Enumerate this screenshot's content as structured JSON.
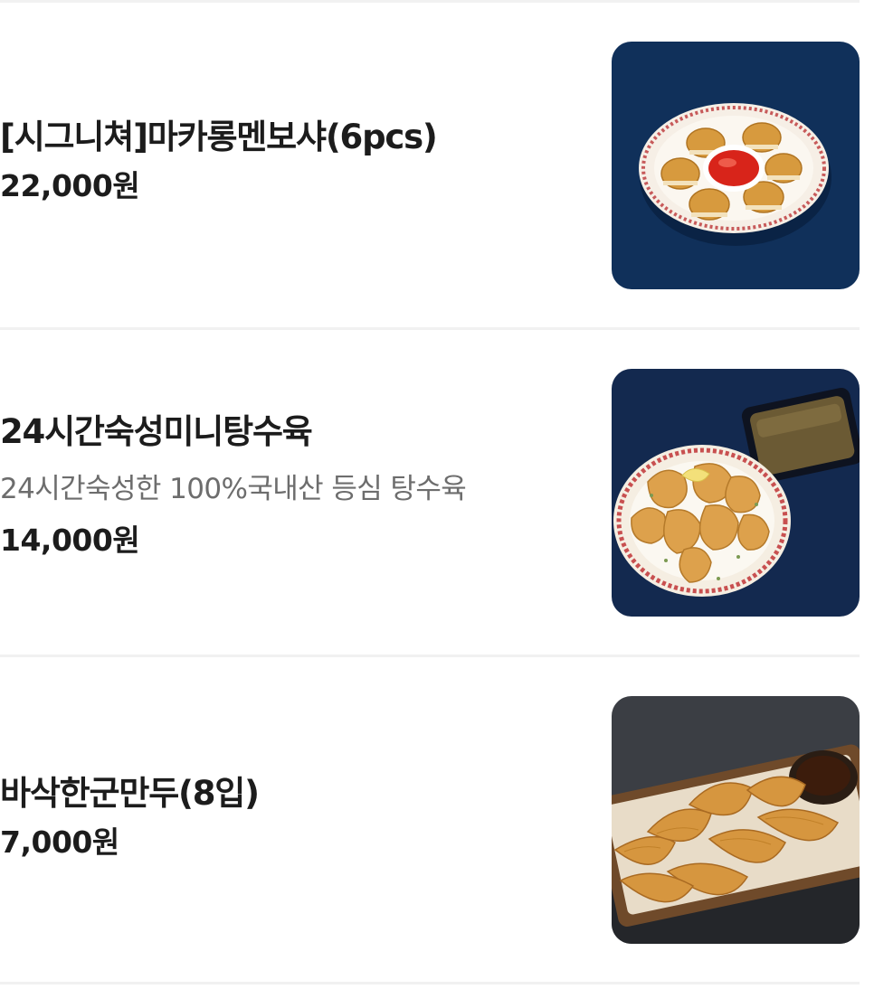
{
  "menu_items": [
    {
      "name": "[시그니쳐]마카롱멘보샤(6pcs)",
      "description": "",
      "price": "22,000원",
      "image": "macaron-menbosha-plate"
    },
    {
      "name": "24시간숙성미니탕수육",
      "description": "24시간숙성한 100%국내산 등심 탕수육",
      "price": "14,000원",
      "image": "mini-tangsuyuk-plate"
    },
    {
      "name": "바삭한군만두(8입)",
      "description": "",
      "price": "7,000원",
      "image": "fried-dumplings-tray"
    }
  ],
  "colors": {
    "navy_background": "#10305a",
    "dark_slate_background": "#3b3e44",
    "price_text": "#1c1c1c",
    "description_text": "#6d6d6d"
  }
}
